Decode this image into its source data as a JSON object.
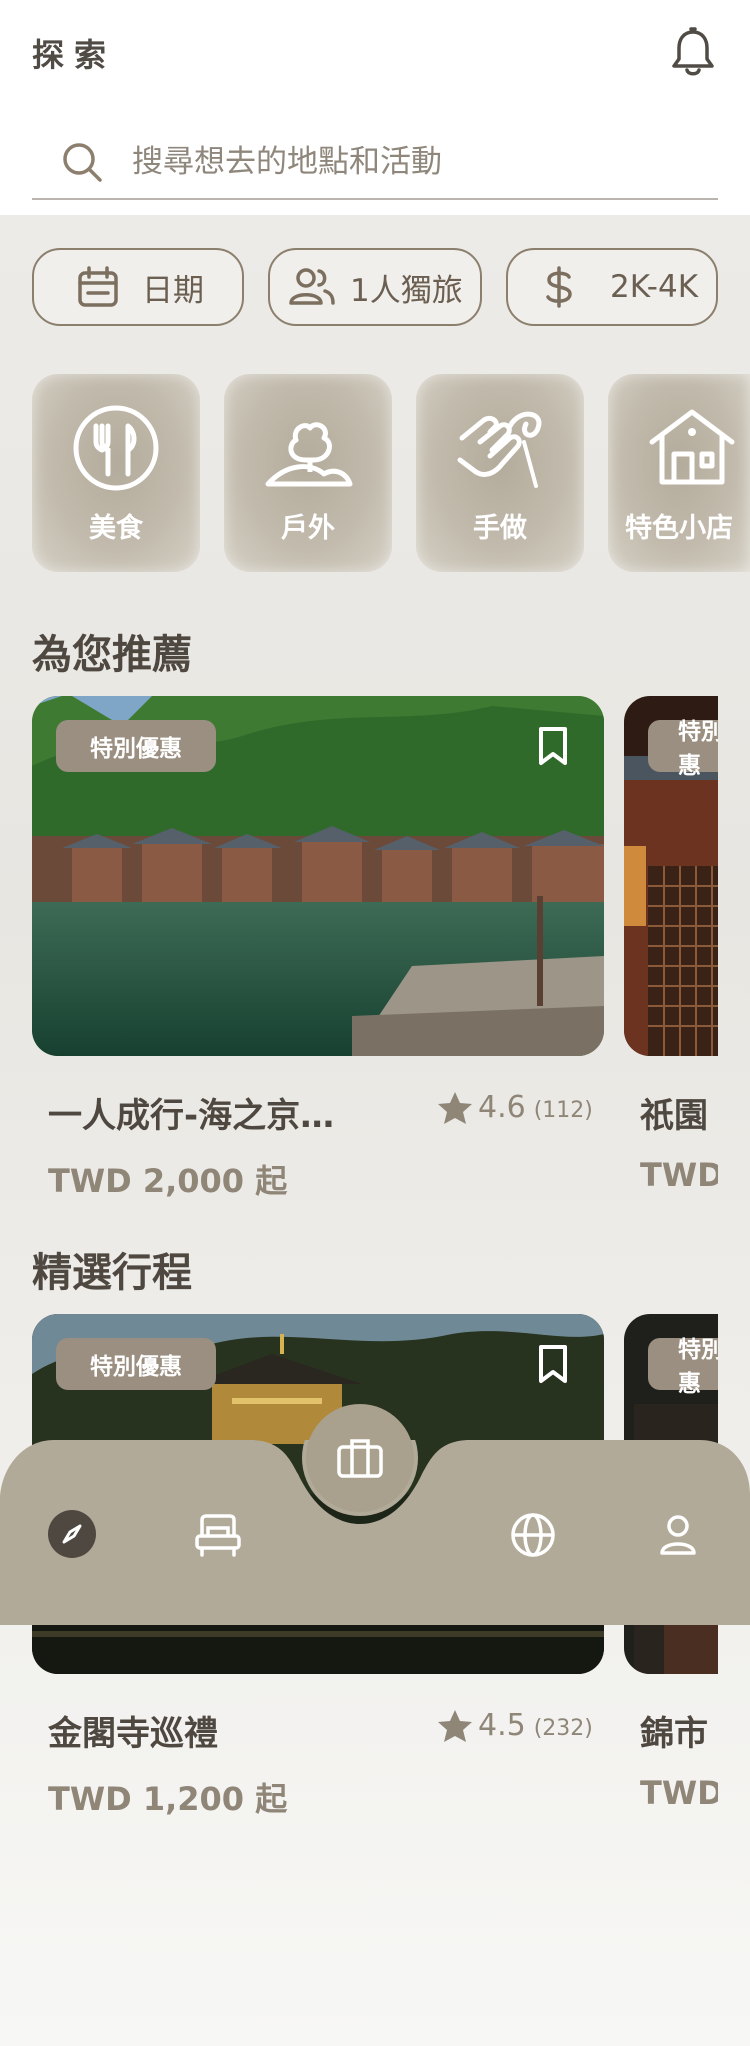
{
  "header": {
    "title": "探索"
  },
  "search": {
    "placeholder": "搜尋想去的地點和活動"
  },
  "filters": {
    "date": "日期",
    "people": "1人獨旅",
    "price": "2K-4K"
  },
  "categories": [
    {
      "label": "美食",
      "icon": "utensils-icon"
    },
    {
      "label": "戶外",
      "icon": "tree-icon"
    },
    {
      "label": "手做",
      "icon": "craft-hand-icon"
    },
    {
      "label": "特色小店",
      "icon": "shop-icon"
    }
  ],
  "recommended": {
    "title": "為您推薦",
    "cards": [
      {
        "badge": "特別優惠",
        "name": "一人成行-海之京…",
        "rating": "4.6",
        "reviews": "(112)",
        "price": "TWD 2,000 起"
      },
      {
        "badge": "特別優惠",
        "name": "祇園",
        "price": "TWD"
      }
    ]
  },
  "featured": {
    "title": "精選行程",
    "cards": [
      {
        "badge": "特別優惠",
        "name": "金閣寺巡禮",
        "rating": "4.5",
        "reviews": "(232)",
        "price": "TWD 1,200 起"
      },
      {
        "badge": "特別優惠",
        "name": "錦市",
        "price": "TWD"
      }
    ]
  },
  "nav": {
    "items": [
      "explore-compass-icon",
      "hotel-bed-icon",
      "trips-briefcase-icon",
      "globe-icon",
      "profile-icon"
    ],
    "active": "explore-compass-icon"
  },
  "colors": {
    "accent": "#a9a08d",
    "nav_bg": "#b2aa98",
    "text_dark": "#4f4841",
    "text_muted": "#8f8678"
  }
}
